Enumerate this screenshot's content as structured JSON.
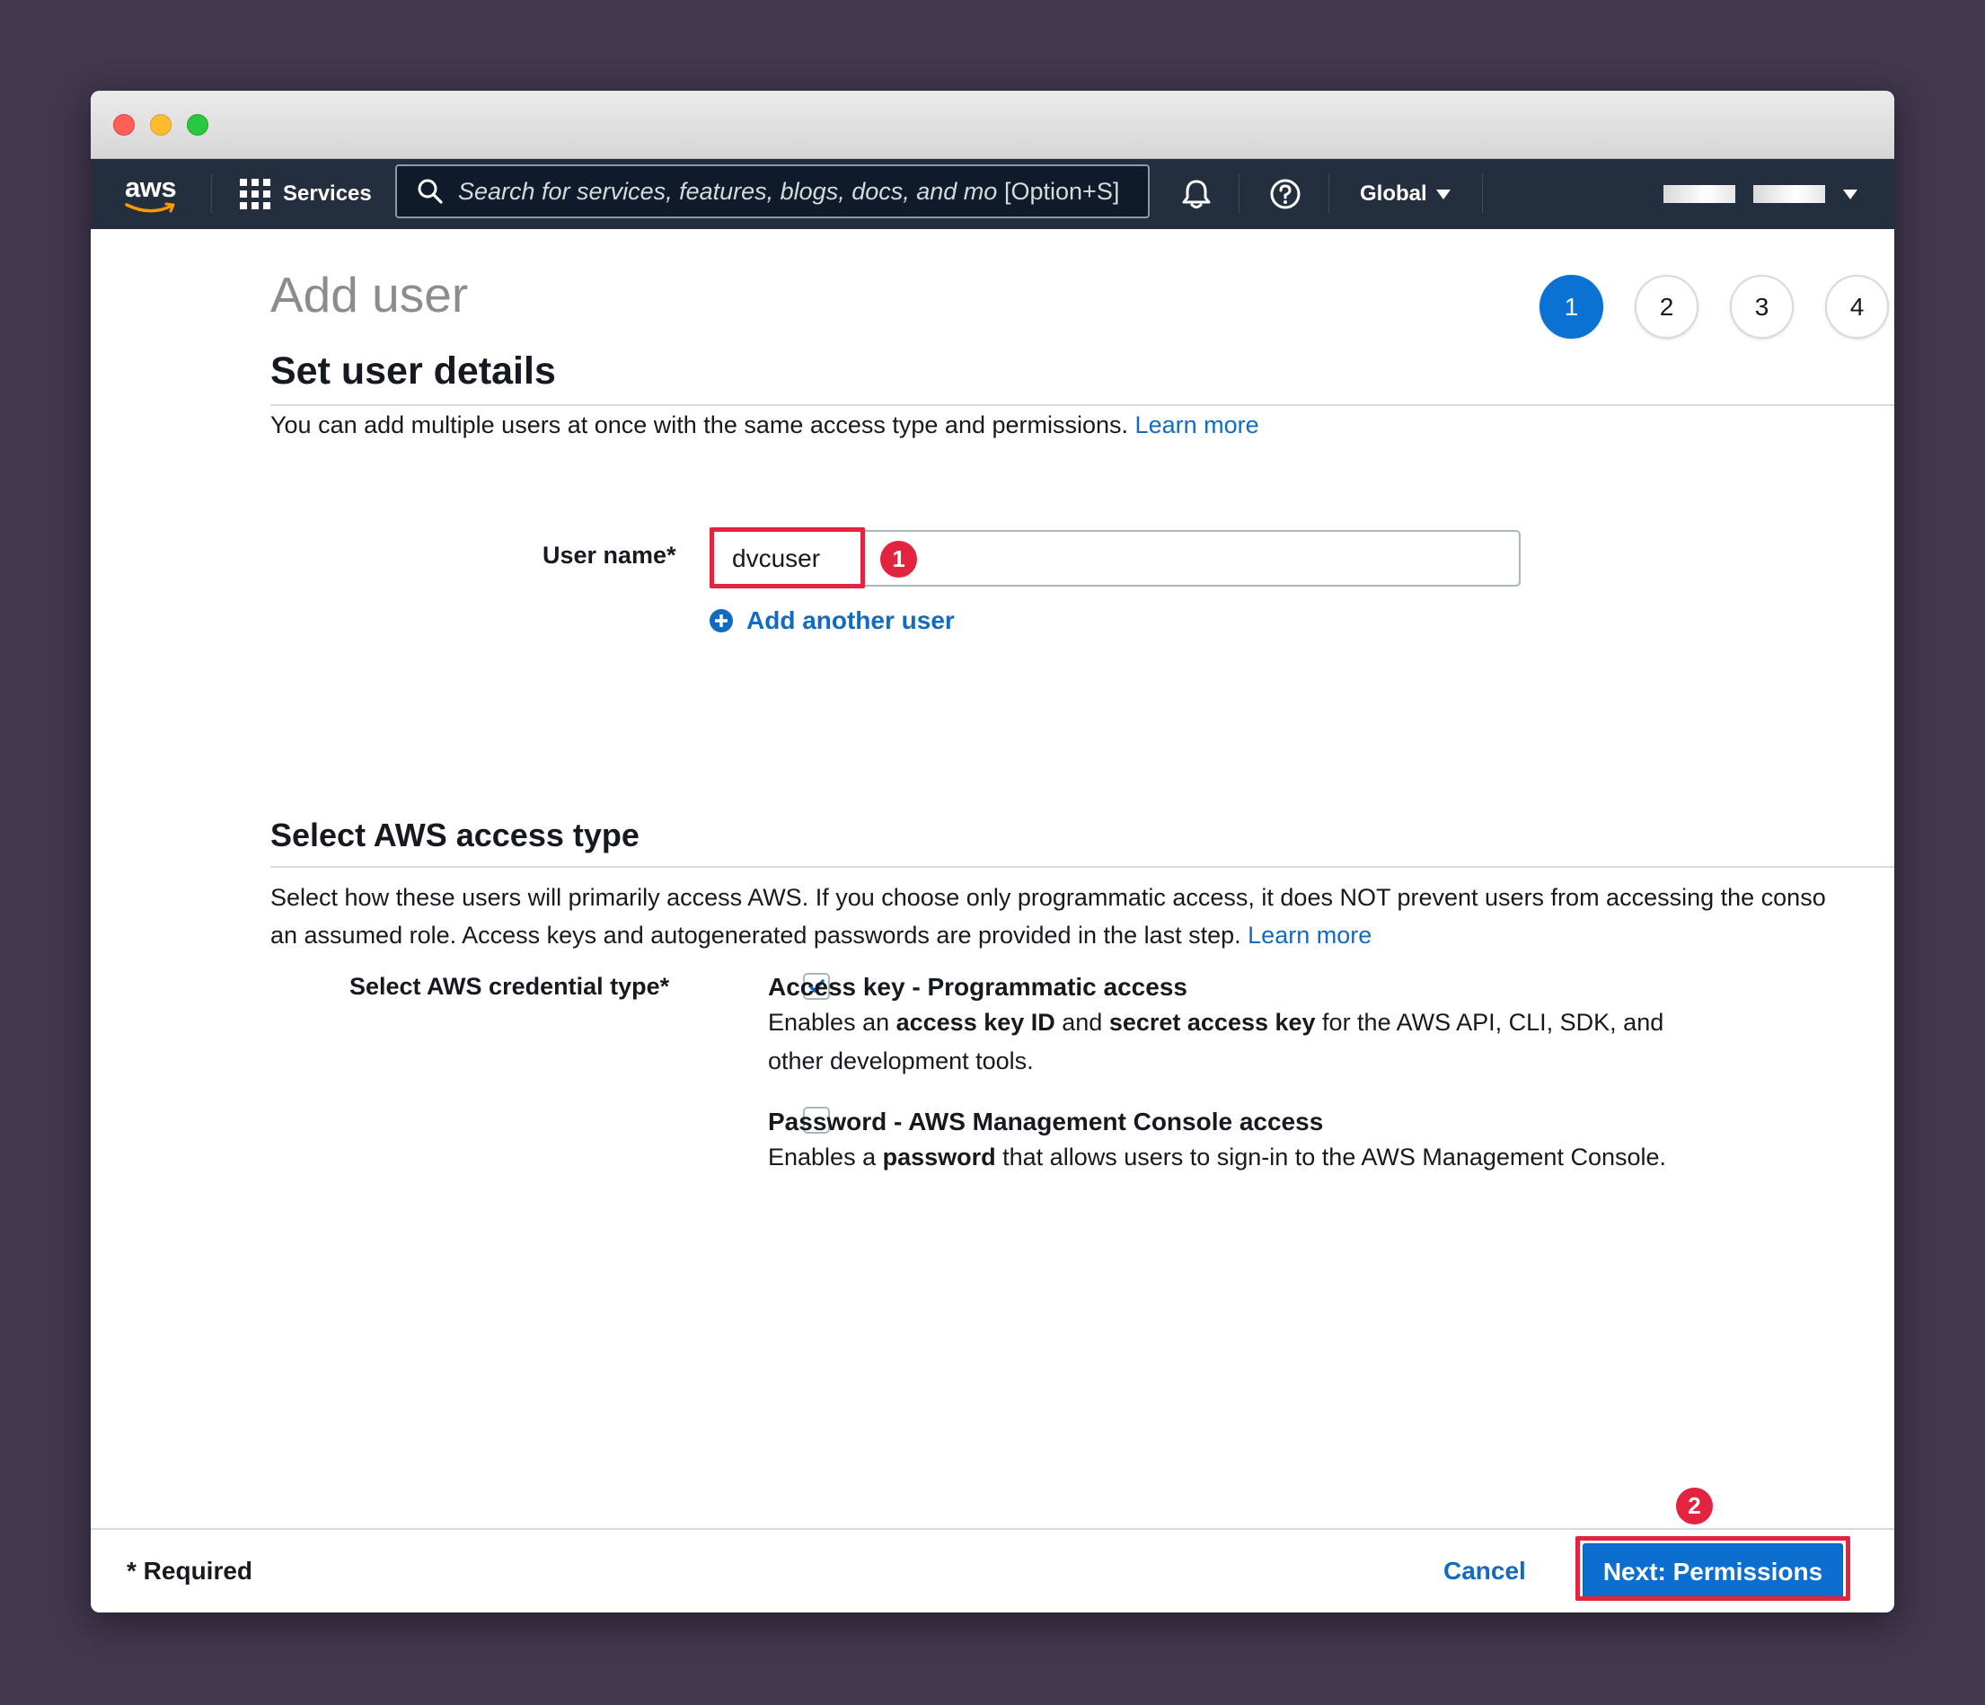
{
  "navbar": {
    "logo": "aws",
    "services_label": "Services",
    "search_placeholder": "Search for services, features, blogs, docs, and mo",
    "search_shortcut": "[Option+S]",
    "region_label": "Global"
  },
  "page": {
    "title": "Add user",
    "steps": [
      "1",
      "2",
      "3",
      "4"
    ],
    "active_step": "1"
  },
  "user_details": {
    "title": "Set user details",
    "description": "You can add multiple users at once with the same access type and permissions.",
    "learn_more": "Learn more",
    "username_label": "User name*",
    "username_value": "dvcuser",
    "add_another_user": "Add another user"
  },
  "access_type": {
    "title": "Select AWS access type",
    "description_line1": "Select how these users will primarily access AWS. If you choose only programmatic access, it does NOT prevent users from accessing the conso",
    "description_line2": "an assumed role. Access keys and autogenerated passwords are provided in the last step.",
    "learn_more": "Learn more",
    "credential_label": "Select AWS credential type*",
    "options": [
      {
        "title": "Access key - Programmatic access",
        "checked": true,
        "desc_parts": [
          "Enables an ",
          "access key ID",
          " and ",
          "secret access key",
          " for the AWS API, CLI, SDK, and other development tools."
        ]
      },
      {
        "title": "Password - AWS Management Console access",
        "checked": false,
        "desc_parts": [
          "Enables a ",
          "password",
          " that allows users to sign-in to the AWS Management Console."
        ]
      }
    ]
  },
  "annotations": {
    "badge1": "1",
    "badge2": "2",
    "highlight_color": "#e3243f"
  },
  "footer": {
    "required": "* Required",
    "cancel": "Cancel",
    "next": "Next: Permissions"
  },
  "colors": {
    "navbar_bg": "#232f3e",
    "link": "#0f6bc3",
    "primary_button": "#0c6fd0",
    "active_step": "#0972d3",
    "backdrop": "#41374e"
  }
}
